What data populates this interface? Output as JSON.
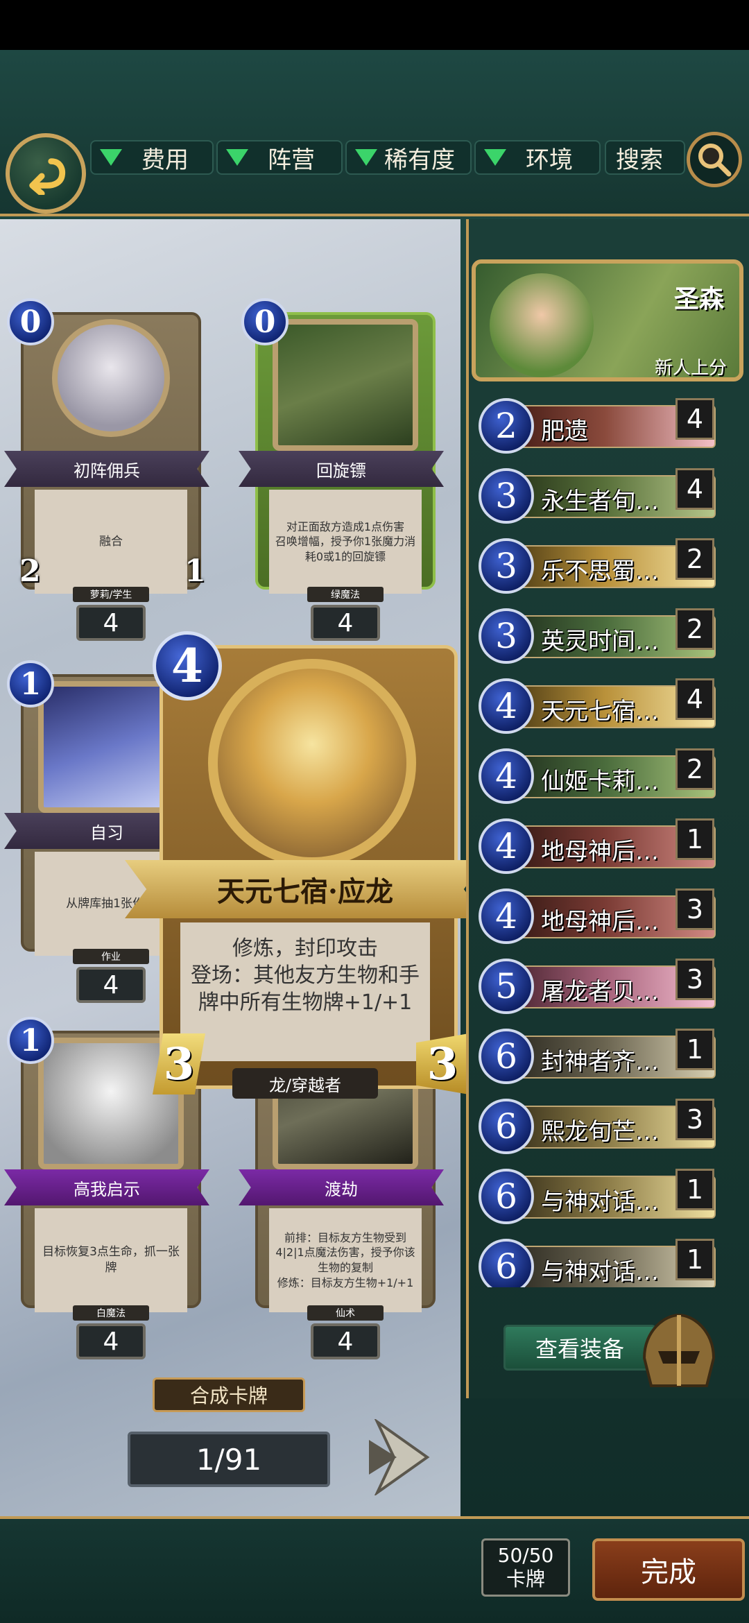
{
  "filters": [
    {
      "label": "费用"
    },
    {
      "label": "阵营"
    },
    {
      "label": "稀有度"
    },
    {
      "label": "环境"
    }
  ],
  "search_label": "搜索",
  "cards": [
    {
      "cost": "0",
      "name": "初阵佣兵",
      "text": "融合",
      "tag": "萝莉/学生",
      "atk": "2",
      "hp": "1",
      "count": "4"
    },
    {
      "cost": "0",
      "name": "回旋镖",
      "text": "对正面敌方造成1点伤害\n召唤增幅，授予你1张魔力消耗0或1的回旋镖",
      "tag": "绿魔法",
      "count": "4"
    },
    {
      "cost": "1",
      "name": "自习",
      "text": "从牌库抽1张作业",
      "tag": "作业",
      "count": "4"
    },
    {
      "cost": "1",
      "name": "高我启示",
      "text": "目标恢复3点生命，抓一张牌",
      "tag": "白魔法",
      "count": "4"
    },
    {
      "name": "渡劫",
      "text": "前排：目标友方生物受到4|2|1点魔法伤害，授予你该生物的复制\n修炼：目标友方生物+1/+1",
      "tag": "仙术",
      "count": "4"
    }
  ],
  "zoom_card": {
    "cost": "4",
    "name": "天元七宿·应龙",
    "desc": "修炼，封印攻击\n登场：其他友方生物和手牌中所有生物牌+1/+1",
    "race": "龙/穿越者",
    "atk": "3",
    "hp": "3"
  },
  "craft_label": "合成卡牌",
  "page_indicator": "1/91",
  "hero": {
    "name": "圣森",
    "subtitle": "新人上分"
  },
  "deck": [
    {
      "cost": "2",
      "name": "肥遗",
      "count": "4"
    },
    {
      "cost": "3",
      "name": "永生者旬…",
      "count": "4"
    },
    {
      "cost": "3",
      "name": "乐不思蜀…",
      "count": "2"
    },
    {
      "cost": "3",
      "name": "英灵时间…",
      "count": "2"
    },
    {
      "cost": "4",
      "name": "天元七宿…",
      "count": "4"
    },
    {
      "cost": "4",
      "name": "仙姬卡莉…",
      "count": "2"
    },
    {
      "cost": "4",
      "name": "地母神后…",
      "count": "1"
    },
    {
      "cost": "4",
      "name": "地母神后…",
      "count": "3"
    },
    {
      "cost": "5",
      "name": "屠龙者贝…",
      "count": "3"
    },
    {
      "cost": "6",
      "name": "封神者齐…",
      "count": "1"
    },
    {
      "cost": "6",
      "name": "熙龙旬芒…",
      "count": "3"
    },
    {
      "cost": "6",
      "name": "与神对话…",
      "count": "1"
    },
    {
      "cost": "6",
      "name": "与神对话…",
      "count": "1"
    }
  ],
  "equip_label": "查看装备",
  "deck_count": {
    "value": "50/50",
    "label": "卡牌"
  },
  "done_label": "完成"
}
